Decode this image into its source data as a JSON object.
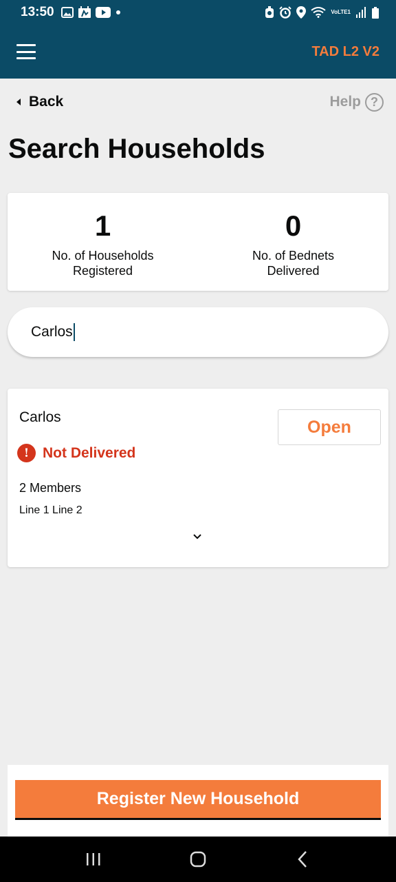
{
  "status_bar": {
    "time": "13:50",
    "left_icons": [
      "gallery-icon",
      "calendar-icon",
      "youtube-icon",
      "dot-icon"
    ],
    "right_icons": [
      "battery-saver-icon",
      "alarm-icon",
      "location-icon",
      "wifi-icon",
      "volte-icon",
      "signal-icon",
      "battery-icon"
    ],
    "network_label": "VoLTE1"
  },
  "app_bar": {
    "title": "TAD L2 V2",
    "menu_icon": "hamburger-menu-icon"
  },
  "nav": {
    "back_label": "Back",
    "help_label": "Help",
    "help_icon": "?"
  },
  "page": {
    "title": "Search Households"
  },
  "summary": {
    "households_value": "1",
    "households_label": "No. of Households Registered",
    "bednets_value": "0",
    "bednets_label": "No. of Bednets Delivered"
  },
  "search": {
    "value": "Carlos"
  },
  "result": {
    "name": "Carlos",
    "open_label": "Open",
    "status_icon": "!",
    "status": "Not Delivered",
    "members": "2 Members",
    "address": "Line 1 Line 2"
  },
  "actions": {
    "register_label": "Register New Household"
  },
  "colors": {
    "primary": "#0b4b66",
    "accent": "#f47c3c",
    "error": "#d4351c",
    "background": "#eeeeee"
  }
}
